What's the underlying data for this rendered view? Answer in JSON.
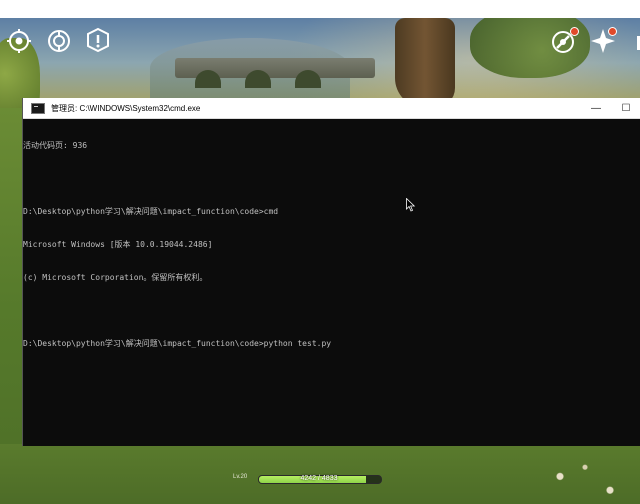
{
  "window": {
    "title": "管理员: C:\\WINDOWS\\System32\\cmd.exe",
    "controls": {
      "minimize": "—",
      "maximize": "☐"
    }
  },
  "console": {
    "lines": [
      "活动代码页: 936",
      "",
      "D:\\Desktop\\python学习\\解决问题\\impact_function\\code>cmd",
      "Microsoft Windows [版本 10.0.19044.2486]",
      "(c) Microsoft Corporation。保留所有权利。",
      "",
      "D:\\Desktop\\python学习\\解决问题\\impact_function\\code>python test.py"
    ]
  },
  "hud": {
    "level": "Lv.20",
    "hp_text": "4242 / 4833",
    "hp_fraction": 0.878,
    "icons": [
      "eye-compass-icon",
      "wish-compass-icon",
      "quest-book-icon",
      "event-compass-icon",
      "paimon-star-icon",
      "menu-icon"
    ],
    "badge_color": "#e04a2a"
  }
}
